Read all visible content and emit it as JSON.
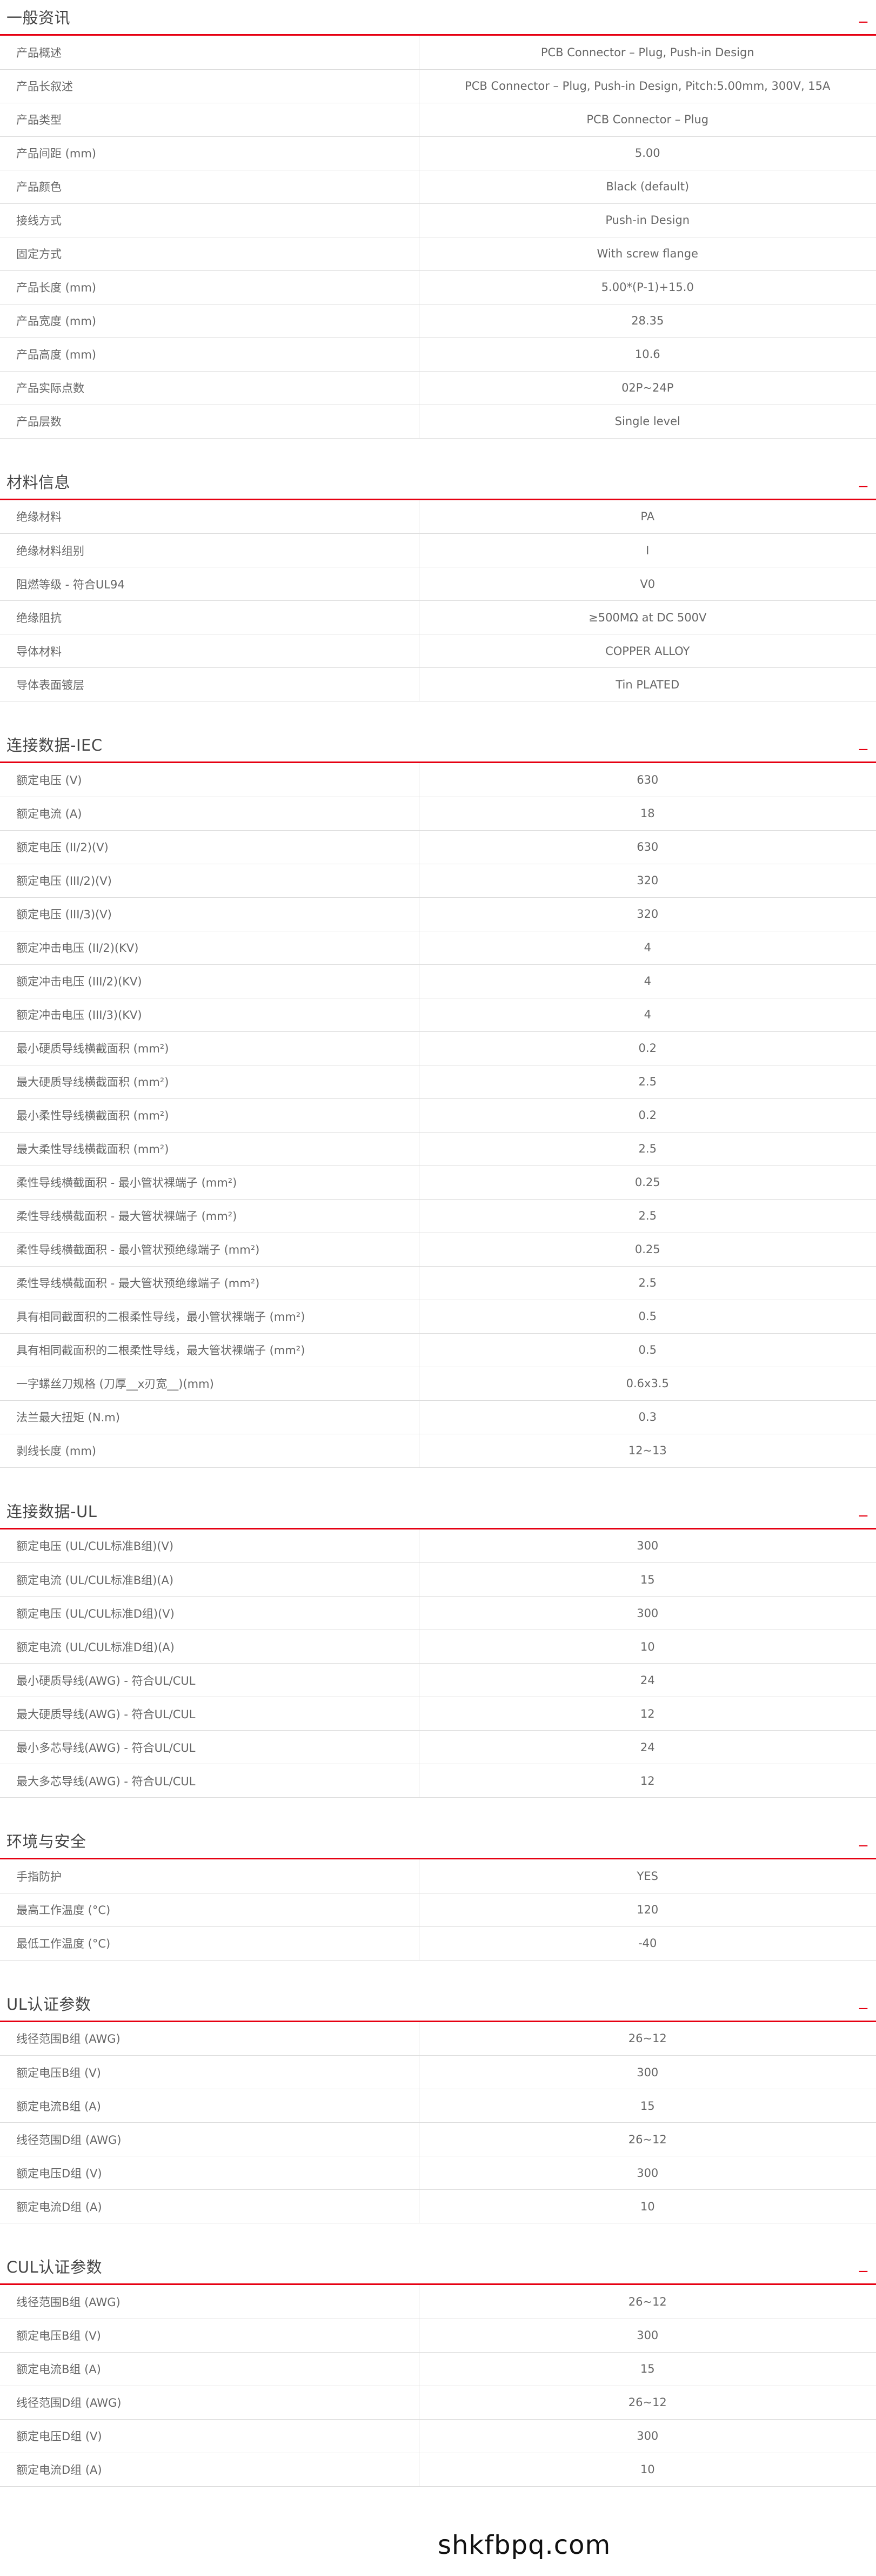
{
  "sections": [
    {
      "title": "一般资讯",
      "toggle": "_",
      "rows": [
        {
          "label": "产品概述",
          "value": "PCB Connector – Plug, Push-in Design"
        },
        {
          "label": "产品长叙述",
          "value": "PCB Connector – Plug, Push-in Design, Pitch:5.00mm, 300V, 15A"
        },
        {
          "label": "产品类型",
          "value": "PCB Connector – Plug"
        },
        {
          "label": "产品间距 (mm)",
          "value": "5.00"
        },
        {
          "label": "产品颜色",
          "value": "Black (default)"
        },
        {
          "label": "接线方式",
          "value": "Push-in Design"
        },
        {
          "label": "固定方式",
          "value": "With screw flange"
        },
        {
          "label": "产品长度 (mm)",
          "value": "5.00*(P-1)+15.0"
        },
        {
          "label": "产品宽度 (mm)",
          "value": "28.35"
        },
        {
          "label": "产品高度 (mm)",
          "value": "10.6"
        },
        {
          "label": "产品实际点数",
          "value": "02P~24P"
        },
        {
          "label": "产品层数",
          "value": "Single level"
        }
      ]
    },
    {
      "title": "材料信息",
      "toggle": "_",
      "rows": [
        {
          "label": "绝缘材料",
          "value": "PA"
        },
        {
          "label": "绝缘材料组别",
          "value": "I"
        },
        {
          "label": "阻燃等级 - 符合UL94",
          "value": "V0"
        },
        {
          "label": "绝缘阻抗",
          "value": "≥500MΩ at DC 500V"
        },
        {
          "label": "导体材料",
          "value": "COPPER ALLOY"
        },
        {
          "label": "导体表面镀层",
          "value": "Tin PLATED"
        }
      ]
    },
    {
      "title": "连接数据-IEC",
      "toggle": "_",
      "rows": [
        {
          "label": "额定电压 (V)",
          "value": "630"
        },
        {
          "label": "额定电流 (A)",
          "value": "18"
        },
        {
          "label": "额定电压 (II/2)(V)",
          "value": "630"
        },
        {
          "label": "额定电压 (III/2)(V)",
          "value": "320"
        },
        {
          "label": "额定电压 (III/3)(V)",
          "value": "320"
        },
        {
          "label": "额定冲击电压 (II/2)(KV)",
          "value": "4"
        },
        {
          "label": "额定冲击电压 (III/2)(KV)",
          "value": "4"
        },
        {
          "label": "额定冲击电压 (III/3)(KV)",
          "value": "4"
        },
        {
          "label": "最小硬质导线横截面积 (mm²)",
          "value": "0.2"
        },
        {
          "label": "最大硬质导线横截面积 (mm²)",
          "value": "2.5"
        },
        {
          "label": "最小柔性导线横截面积 (mm²)",
          "value": "0.2"
        },
        {
          "label": "最大柔性导线横截面积 (mm²)",
          "value": "2.5"
        },
        {
          "label": "柔性导线横截面积 - 最小管状裸端子 (mm²)",
          "value": "0.25"
        },
        {
          "label": "柔性导线横截面积 - 最大管状裸端子 (mm²)",
          "value": "2.5"
        },
        {
          "label": "柔性导线横截面积 - 最小管状预绝缘端子 (mm²)",
          "value": "0.25"
        },
        {
          "label": "柔性导线横截面积 - 最大管状预绝缘端子 (mm²)",
          "value": "2.5"
        },
        {
          "label": "具有相同截面积的二根柔性导线，最小管状裸端子 (mm²)",
          "value": "0.5"
        },
        {
          "label": "具有相同截面积的二根柔性导线，最大管状裸端子 (mm²)",
          "value": "0.5"
        },
        {
          "label": "一字螺丝刀规格 (刀厚__x刃宽__)(mm)",
          "value": "0.6x3.5"
        },
        {
          "label": "法兰最大扭矩 (N.m)",
          "value": "0.3"
        },
        {
          "label": "剥线长度 (mm)",
          "value": "12~13"
        }
      ]
    },
    {
      "title": "连接数据-UL",
      "toggle": "_",
      "rows": [
        {
          "label": "额定电压 (UL/CUL标准B组)(V)",
          "value": "300"
        },
        {
          "label": "额定电流 (UL/CUL标准B组)(A)",
          "value": "15"
        },
        {
          "label": "额定电压 (UL/CUL标准D组)(V)",
          "value": "300"
        },
        {
          "label": "额定电流 (UL/CUL标准D组)(A)",
          "value": "10"
        },
        {
          "label": "最小硬质导线(AWG) - 符合UL/CUL",
          "value": "24"
        },
        {
          "label": "最大硬质导线(AWG) - 符合UL/CUL",
          "value": "12"
        },
        {
          "label": "最小多芯导线(AWG) - 符合UL/CUL",
          "value": "24"
        },
        {
          "label": "最大多芯导线(AWG) - 符合UL/CUL",
          "value": "12"
        }
      ]
    },
    {
      "title": "环境与安全",
      "toggle": "_",
      "rows": [
        {
          "label": "手指防护",
          "value": "YES"
        },
        {
          "label": "最高工作温度 (°C)",
          "value": "120"
        },
        {
          "label": "最低工作温度 (°C)",
          "value": "-40"
        }
      ]
    },
    {
      "title": "UL认证参数",
      "toggle": "_",
      "rows": [
        {
          "label": "线径范围B组 (AWG)",
          "value": "26~12"
        },
        {
          "label": "额定电压B组 (V)",
          "value": "300"
        },
        {
          "label": "额定电流B组 (A)",
          "value": "15"
        },
        {
          "label": "线径范围D组 (AWG)",
          "value": "26~12"
        },
        {
          "label": "额定电压D组 (V)",
          "value": "300"
        },
        {
          "label": "额定电流D组 (A)",
          "value": "10"
        }
      ]
    },
    {
      "title": "CUL认证参数",
      "toggle": "_",
      "rows": [
        {
          "label": "线径范围B组 (AWG)",
          "value": "26~12"
        },
        {
          "label": "额定电压B组 (V)",
          "value": "300"
        },
        {
          "label": "额定电流B组 (A)",
          "value": "15"
        },
        {
          "label": "线径范围D组 (AWG)",
          "value": "26~12"
        },
        {
          "label": "额定电压D组 (V)",
          "value": "300"
        },
        {
          "label": "额定电流D组 (A)",
          "value": "10"
        }
      ]
    }
  ],
  "watermark": "shkfbpq.com",
  "colors": {
    "accent": "#e60012",
    "border": "#dddddd",
    "text": "#666666"
  }
}
